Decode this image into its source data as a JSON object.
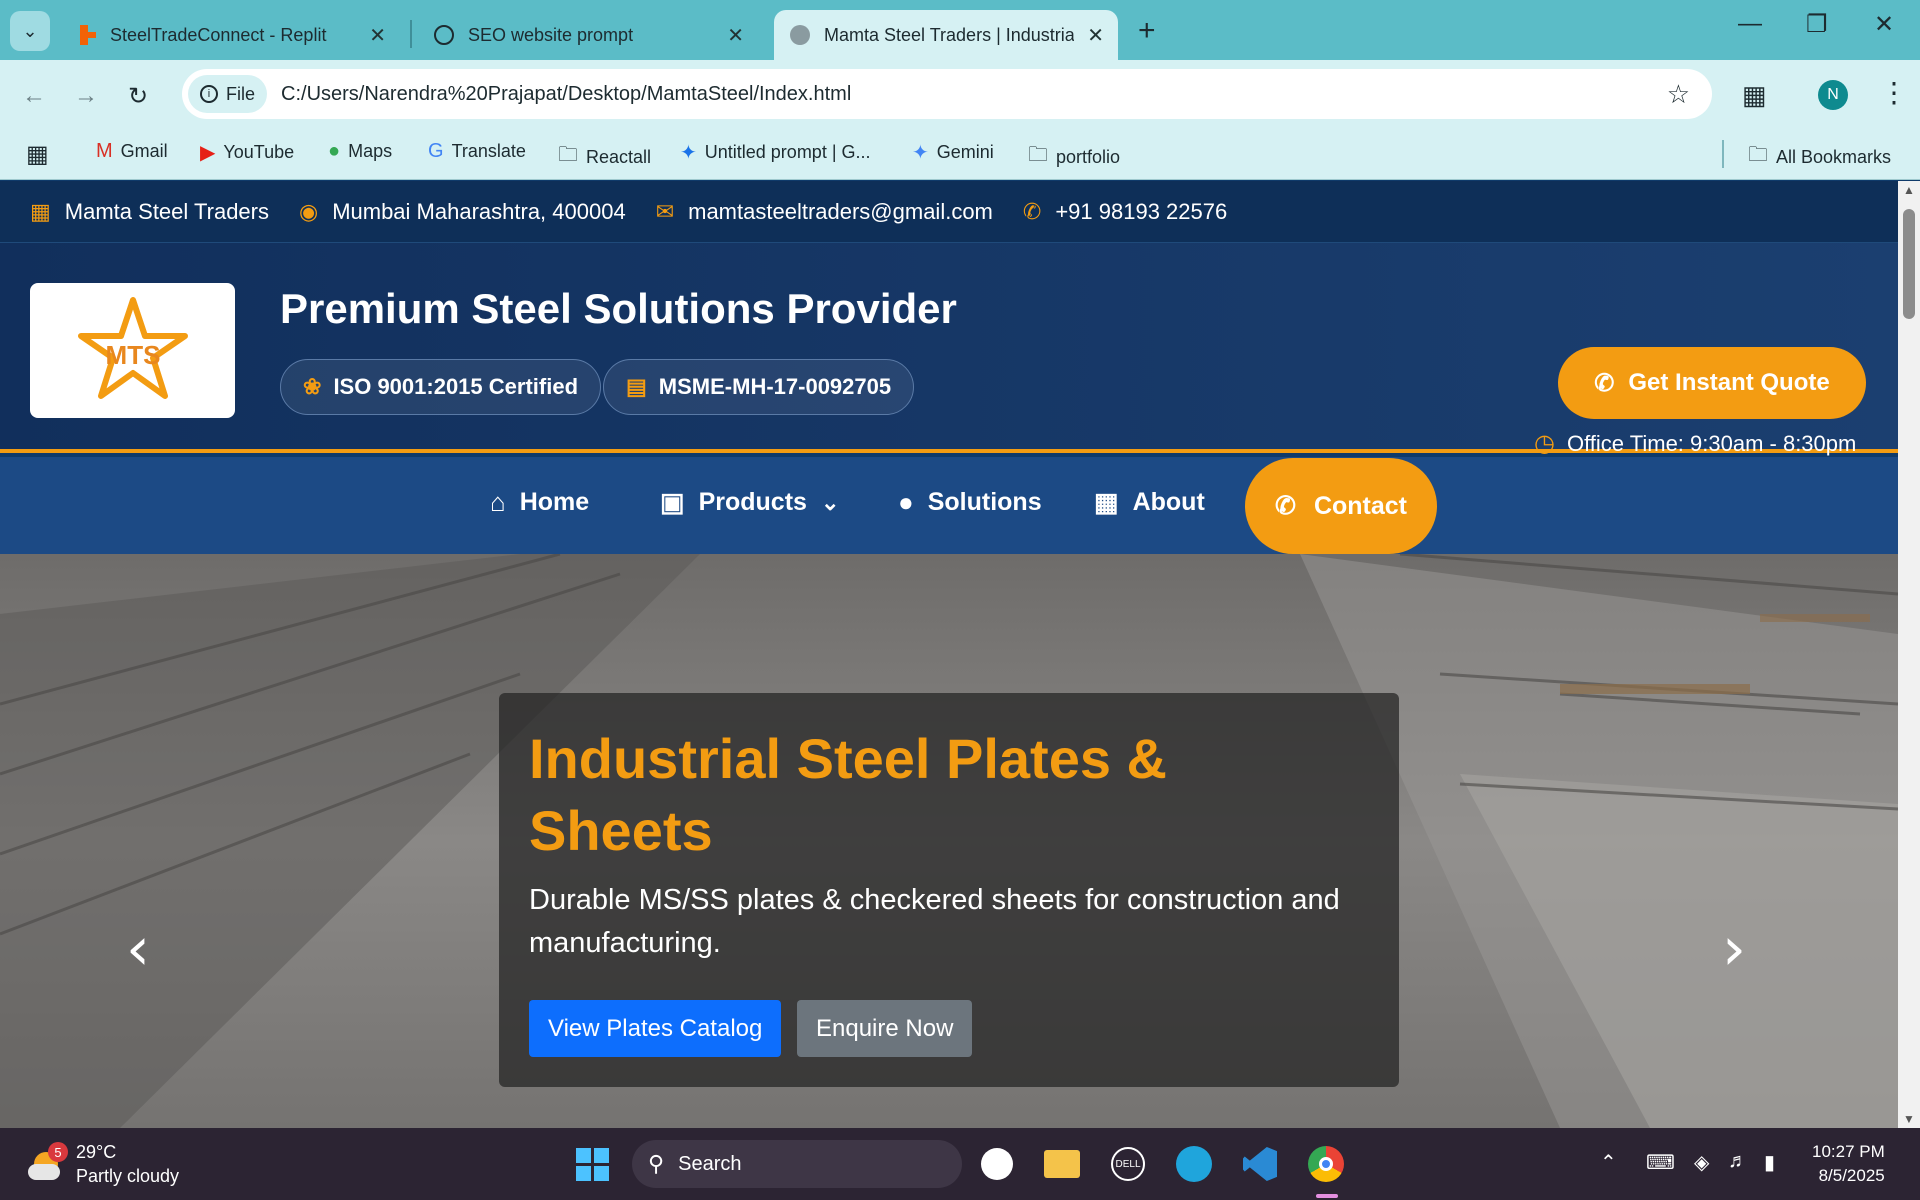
{
  "browser": {
    "tabs": [
      {
        "title": "SteelTradeConnect - Replit"
      },
      {
        "title": "SEO website prompt"
      },
      {
        "title": "Mamta Steel Traders | Industrial"
      }
    ],
    "address": {
      "scheme_label": "File",
      "url": "C:/Users/Narendra%20Prajapat/Desktop/MamtaSteel/Index.html"
    },
    "profile_initial": "N",
    "bookmarks": [
      "Gmail",
      "YouTube",
      "Maps",
      "Translate",
      "Reactall",
      "Untitled prompt | G...",
      "Gemini",
      "portfolio"
    ],
    "all_bookmarks": "All Bookmarks"
  },
  "topbar": {
    "company": "Mamta Steel Traders",
    "location": "Mumbai Maharashtra, 400004",
    "email": "mamtasteeltraders@gmail.com",
    "phone": "+91 98193 22576"
  },
  "header": {
    "logo_text": "MTS",
    "title": "Premium Steel Solutions Provider",
    "badges": [
      "ISO 9001:2015 Certified",
      "MSME-MH-17-0092705"
    ],
    "quote_button": "Get Instant Quote",
    "office_time": "Office Time: 9:30am - 8:30pm"
  },
  "nav": {
    "home": "Home",
    "products": "Products",
    "solutions": "Solutions",
    "about": "About",
    "contact": "Contact"
  },
  "hero": {
    "title": "Industrial Steel Plates & Sheets",
    "description": "Durable MS/SS plates & checkered sheets for construction and manufacturing.",
    "primary_button": "View Plates Catalog",
    "secondary_button": "Enquire Now"
  },
  "taskbar": {
    "weather_temp": "29°C",
    "weather_desc": "Partly cloudy",
    "weather_badge": "5",
    "search_label": "Search",
    "time": "10:27 PM",
    "date": "8/5/2025"
  },
  "colors": {
    "accent": "#f39c12",
    "navy": "#0e2f58",
    "nav_blue": "#1c4a85",
    "primary_btn": "#0d6efd"
  }
}
